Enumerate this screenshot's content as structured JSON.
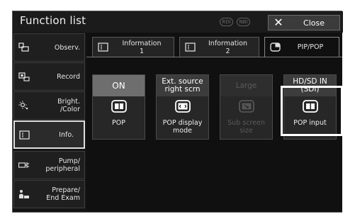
{
  "window": {
    "title": "Function list",
    "indicators": [
      "RDI",
      "NBI"
    ],
    "close_label": "Close",
    "close_glyph": "✕"
  },
  "sidebar": {
    "items": [
      {
        "label": "Observ.",
        "icon": "observation-icon",
        "active": false
      },
      {
        "label": "Record",
        "icon": "record-icon",
        "active": false
      },
      {
        "label": "Bright.\n/Color",
        "icon": "brightness-icon",
        "active": false
      },
      {
        "label": "Info.",
        "icon": "info-icon",
        "active": true
      },
      {
        "label": "Pump/\nperipheral",
        "icon": "pump-icon",
        "active": false
      },
      {
        "label": "Prepare/\nEnd Exam",
        "icon": "prepare-icon",
        "active": false
      }
    ]
  },
  "tabs": [
    {
      "label": "Information\n1",
      "icon": "monitor-icon",
      "active": false
    },
    {
      "label": "Information\n2",
      "icon": "monitor-icon",
      "active": false
    },
    {
      "label": "PIP/POP",
      "icon": "pip-icon",
      "active": true
    }
  ],
  "functions": [
    {
      "top": "ON",
      "label": "POP",
      "icon": "pop-icon",
      "enabled": true
    },
    {
      "top": "Ext. source\nright scrn",
      "label": "POP display\nmode",
      "icon": "pop-display-mode-icon",
      "enabled": true
    },
    {
      "top": "Large",
      "label": "Sub screen\nsize",
      "icon": "sub-screen-size-icon",
      "enabled": false
    },
    {
      "top": "HD/SD IN\n(SDI)",
      "label": "POP input",
      "icon": "pop-input-icon",
      "enabled": true
    }
  ],
  "colors": {
    "background": "#141414",
    "button": "#272727",
    "on_state": "#6e6e6e",
    "highlight": "#ffffff"
  }
}
